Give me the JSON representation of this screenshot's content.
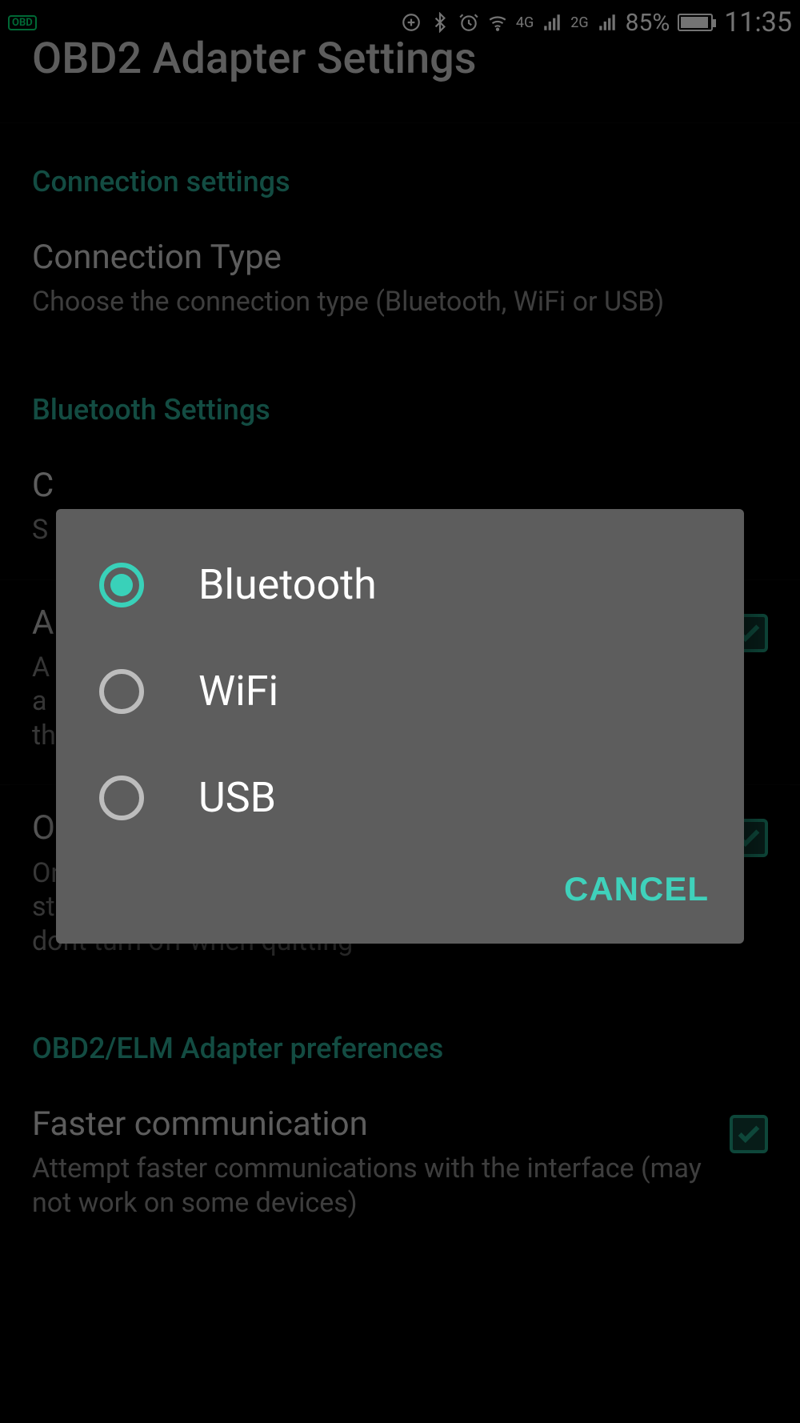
{
  "status": {
    "obd_chip": "OBD",
    "battery_pct": "85%",
    "clock": "11:35",
    "net1": "4G",
    "net2": "2G"
  },
  "page": {
    "title": "OBD2 Adapter Settings",
    "sections": {
      "connection": {
        "header": "Connection settings",
        "connection_type": {
          "title": "Connection Type",
          "sub": "Choose the connection type (Bluetooth, WiFi or USB)"
        }
      },
      "bluetooth": {
        "header": "Bluetooth Settings",
        "choose_device": {
          "title_partial": "C",
          "sub_partial": "S"
        },
        "auto_bt": {
          "title_partial": "A",
          "sub_partial": "A\na\nth",
          "checked": true
        },
        "only_if_on": {
          "title": "Only if BT was already on",
          "sub": "Only turns on/off Bluetooth if it was off when Torque started. If Bluetooth was already on then ignore and dont turn off when quitting",
          "checked": true
        }
      },
      "adapter": {
        "header": "OBD2/ELM Adapter preferences",
        "faster": {
          "title": "Faster communication",
          "sub": "Attempt faster communications with the interface (may not work on some devices)",
          "checked": true
        }
      }
    }
  },
  "dialog": {
    "options": [
      {
        "label": "Bluetooth",
        "selected": true
      },
      {
        "label": "WiFi",
        "selected": false
      },
      {
        "label": "USB",
        "selected": false
      }
    ],
    "cancel": "CANCEL"
  }
}
